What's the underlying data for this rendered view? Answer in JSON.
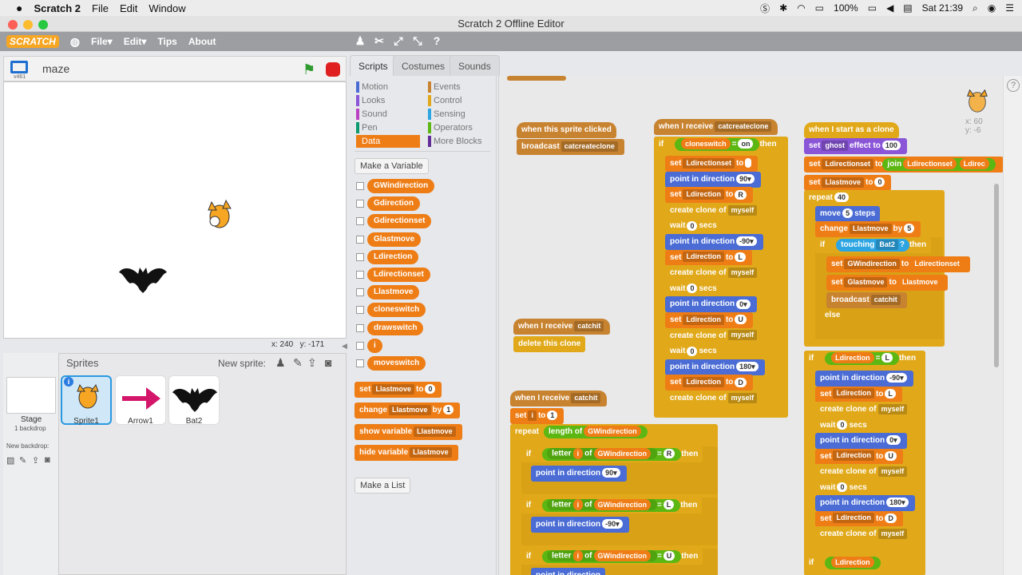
{
  "menubar": {
    "app": "Scratch 2",
    "items": [
      "File",
      "Edit",
      "Window"
    ],
    "battery": "100%",
    "clock": "Sat 21:39"
  },
  "window": {
    "title": "Scratch 2 Offline Editor"
  },
  "scratch_menu": {
    "logo": "SCRATCH",
    "file": "File▾",
    "edit": "Edit▾",
    "tips": "Tips",
    "about": "About"
  },
  "stage": {
    "version": "v461",
    "project_name": "maze",
    "coords_x": "x: 240",
    "coords_y": "y: -171"
  },
  "sprites_panel": {
    "title": "Sprites",
    "new_sprite": "New sprite:",
    "stage_label": "Stage",
    "backdrop_count": "1 backdrop",
    "new_backdrop": "New backdrop:",
    "sprites": [
      {
        "name": "Sprite1"
      },
      {
        "name": "Arrow1"
      },
      {
        "name": "Bat2"
      }
    ]
  },
  "tabs": {
    "scripts": "Scripts",
    "costumes": "Costumes",
    "sounds": "Sounds"
  },
  "categories": {
    "motion": "Motion",
    "looks": "Looks",
    "sound": "Sound",
    "pen": "Pen",
    "data": "Data",
    "events": "Events",
    "control": "Control",
    "sensing": "Sensing",
    "operators": "Operators",
    "more": "More Blocks"
  },
  "palette": {
    "make_variable": "Make a Variable",
    "make_list": "Make a List",
    "variables": [
      "GWindirection",
      "Gdirection",
      "Gdirectionset",
      "Glastmove",
      "Ldirection",
      "Ldirectionset",
      "Llastmove",
      "cloneswitch",
      "drawswitch",
      "i",
      "moveswitch"
    ],
    "set": "set",
    "set_var": "Llastmove",
    "set_val": "0",
    "change": "change",
    "change_var": "Llastmove",
    "by": "by",
    "change_val": "1",
    "show": "show variable",
    "show_var": "Llastmove",
    "hide": "hide variable",
    "hide_var": "Llastmove",
    "to": "to"
  },
  "script_area": {
    "sprite_x": "x: 60",
    "sprite_y": "y: -6"
  },
  "script1": {
    "hat": "when this sprite clicked",
    "broadcast": "broadcast",
    "msg": "catcreateclone"
  },
  "script2": {
    "hat": "when I receive",
    "msg": "catchit",
    "del": "delete this clone"
  },
  "script3": {
    "hat": "when I receive",
    "msg": "catcreateclone",
    "if": "if",
    "cloneswitch": "cloneswitch",
    "eq": "=",
    "on": "on",
    "then": "then",
    "rows": [
      {
        "t": "set",
        "v": "Ldirectionset",
        "to": "to",
        "x": ""
      },
      {
        "t": "point in direction",
        "x": "90▾"
      },
      {
        "t": "set",
        "v": "Ldirection",
        "to": "to",
        "x": "R"
      },
      {
        "t": "create clone of",
        "d": "myself"
      },
      {
        "t": "wait",
        "x": "0",
        "s": "secs"
      },
      {
        "t": "point in direction",
        "x": "-90▾"
      },
      {
        "t": "set",
        "v": "Ldirection",
        "to": "to",
        "x": "L"
      },
      {
        "t": "create clone of",
        "d": "myself"
      },
      {
        "t": "wait",
        "x": "0",
        "s": "secs"
      },
      {
        "t": "point in direction",
        "x": "0▾"
      },
      {
        "t": "set",
        "v": "Ldirection",
        "to": "to",
        "x": "U"
      },
      {
        "t": "create clone of",
        "d": "myself"
      },
      {
        "t": "wait",
        "x": "0",
        "s": "secs"
      },
      {
        "t": "point in direction",
        "x": "180▾"
      },
      {
        "t": "set",
        "v": "Ldirection",
        "to": "to",
        "x": "D"
      },
      {
        "t": "create clone of",
        "d": "myself"
      }
    ]
  },
  "script4": {
    "hat": "when I receive",
    "msg": "catchit",
    "set": "set",
    "var": "i",
    "to": "to",
    "val": "1",
    "repeat": "repeat",
    "length": "length of",
    "len_var": "GWindirection",
    "letter": "letter",
    "of": "of",
    "eq": "=",
    "then": "then",
    "if": "if",
    "point": "point in direction",
    "rows": [
      {
        "i": "i",
        "v": "GWindirection",
        "c": "R",
        "p": "90▾"
      },
      {
        "i": "i",
        "v": "GWindirection",
        "c": "L",
        "p": "-90▾"
      },
      {
        "i": "i",
        "v": "GWindirection",
        "c": "U",
        "p": ""
      }
    ]
  },
  "script5": {
    "hat": "when I start as a clone",
    "set": "set",
    "effect": "ghost",
    "effect_to": "effect to",
    "effect_val": "100",
    "set_ld": "Ldirectionset",
    "to": "to",
    "join": "join",
    "join1": "Ldirectionset",
    "join2": "Ldirec",
    "set_lm": "Llastmove",
    "lm_val": "0",
    "repeat": "repeat",
    "rep_val": "40",
    "move": "move",
    "steps": "steps",
    "move_val": "5",
    "change": "change",
    "change_var": "Llastmove",
    "by": "by",
    "change_val": "5",
    "if": "if",
    "touching": "touching",
    "touch_target": "Bat2",
    "q": "?",
    "then": "then",
    "set_gw": "GWindirection",
    "gw_to": "Ldirectionset",
    "set_gl": "Glastmove",
    "gl_to": "Llastmove",
    "broadcast": "broadcast",
    "bmsg": "catchit",
    "else": "else",
    "if2_var": "Ldirection",
    "if2_eq": "=",
    "if2_val": "L",
    "rows": [
      {
        "t": "point in direction",
        "x": "-90▾"
      },
      {
        "t": "set",
        "v": "Ldirection",
        "to": "to",
        "x": "L"
      },
      {
        "t": "create clone of",
        "d": "myself"
      },
      {
        "t": "wait",
        "x": "0",
        "s": "secs"
      },
      {
        "t": "point in direction",
        "x": "0▾"
      },
      {
        "t": "set",
        "v": "Ldirection",
        "to": "to",
        "x": "U"
      },
      {
        "t": "create clone of",
        "d": "myself"
      },
      {
        "t": "wait",
        "x": "0",
        "s": "secs"
      },
      {
        "t": "point in direction",
        "x": "180▾"
      },
      {
        "t": "set",
        "v": "Ldirection",
        "to": "to",
        "x": "D"
      },
      {
        "t": "create clone of",
        "d": "myself"
      }
    ],
    "if3_var": "Ldirection"
  },
  "colors": {
    "events": "#c88330",
    "control": "#e1a91a",
    "motion": "#4a6cd4",
    "data": "#ee7d16",
    "operators": "#5cb712",
    "looks": "#8a55d7",
    "sensing": "#2ca5e2",
    "pen": "#0e9a6c",
    "sound": "#bb42c3",
    "more": "#632d99"
  }
}
